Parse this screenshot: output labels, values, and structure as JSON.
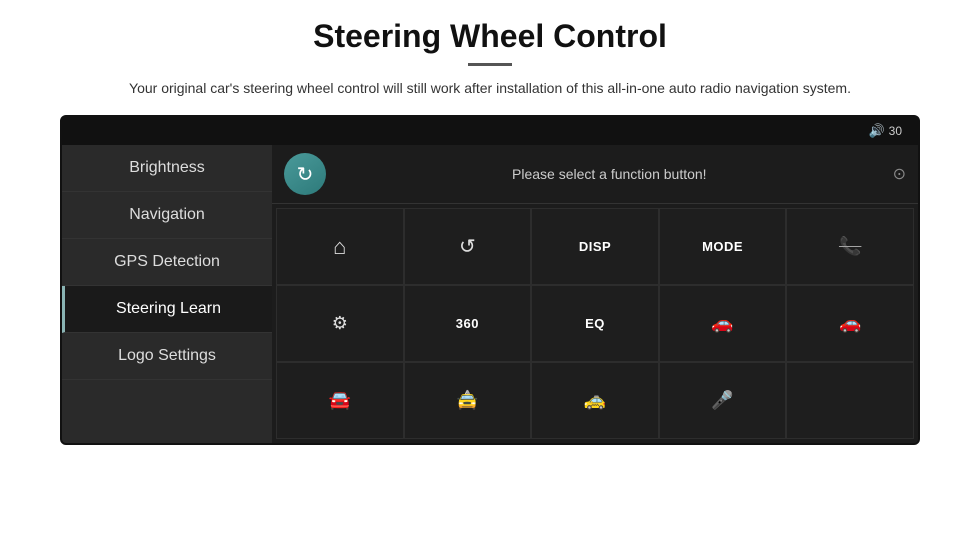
{
  "page": {
    "title": "Steering Wheel Control",
    "subtitle": "Your original car's steering wheel control will still work after installation of this all-in-one auto radio navigation system.",
    "divider_color": "#555"
  },
  "top_bar": {
    "volume_label": "30",
    "speaker_symbol": "🔊"
  },
  "sidebar": {
    "items": [
      {
        "id": "brightness",
        "label": "Brightness",
        "active": false
      },
      {
        "id": "navigation",
        "label": "Navigation",
        "active": false
      },
      {
        "id": "gps-detection",
        "label": "GPS Detection",
        "active": false
      },
      {
        "id": "steering-learn",
        "label": "Steering Learn",
        "active": true
      },
      {
        "id": "logo-settings",
        "label": "Logo Settings",
        "active": false
      }
    ]
  },
  "right_panel": {
    "refresh_icon": "↻",
    "prompt_text": "Please select a function button!",
    "top_right_symbol": "⊙"
  },
  "grid_cells": [
    {
      "id": "home",
      "type": "icon",
      "symbol": "⌂",
      "label": ""
    },
    {
      "id": "back",
      "type": "icon",
      "symbol": "↺",
      "label": ""
    },
    {
      "id": "disp",
      "type": "label",
      "symbol": "",
      "label": "DISP"
    },
    {
      "id": "mode",
      "type": "label",
      "symbol": "",
      "label": "MODE"
    },
    {
      "id": "mute-phone",
      "type": "icon",
      "symbol": "🚫",
      "label": ""
    },
    {
      "id": "tune",
      "type": "icon",
      "symbol": "⚙",
      "label": ""
    },
    {
      "id": "360",
      "type": "label",
      "symbol": "",
      "label": "360"
    },
    {
      "id": "eq",
      "type": "label",
      "symbol": "",
      "label": "EQ"
    },
    {
      "id": "car-cam1",
      "type": "icon",
      "symbol": "🚗",
      "label": ""
    },
    {
      "id": "car-cam2",
      "type": "icon",
      "symbol": "🚗",
      "label": ""
    },
    {
      "id": "car-front",
      "type": "icon",
      "symbol": "🚘",
      "label": ""
    },
    {
      "id": "car-side",
      "type": "icon",
      "symbol": "🚖",
      "label": ""
    },
    {
      "id": "car-back",
      "type": "icon",
      "symbol": "🚕",
      "label": ""
    },
    {
      "id": "mic",
      "type": "icon",
      "symbol": "🎤",
      "label": ""
    },
    {
      "id": "empty",
      "type": "empty",
      "symbol": "",
      "label": ""
    }
  ]
}
